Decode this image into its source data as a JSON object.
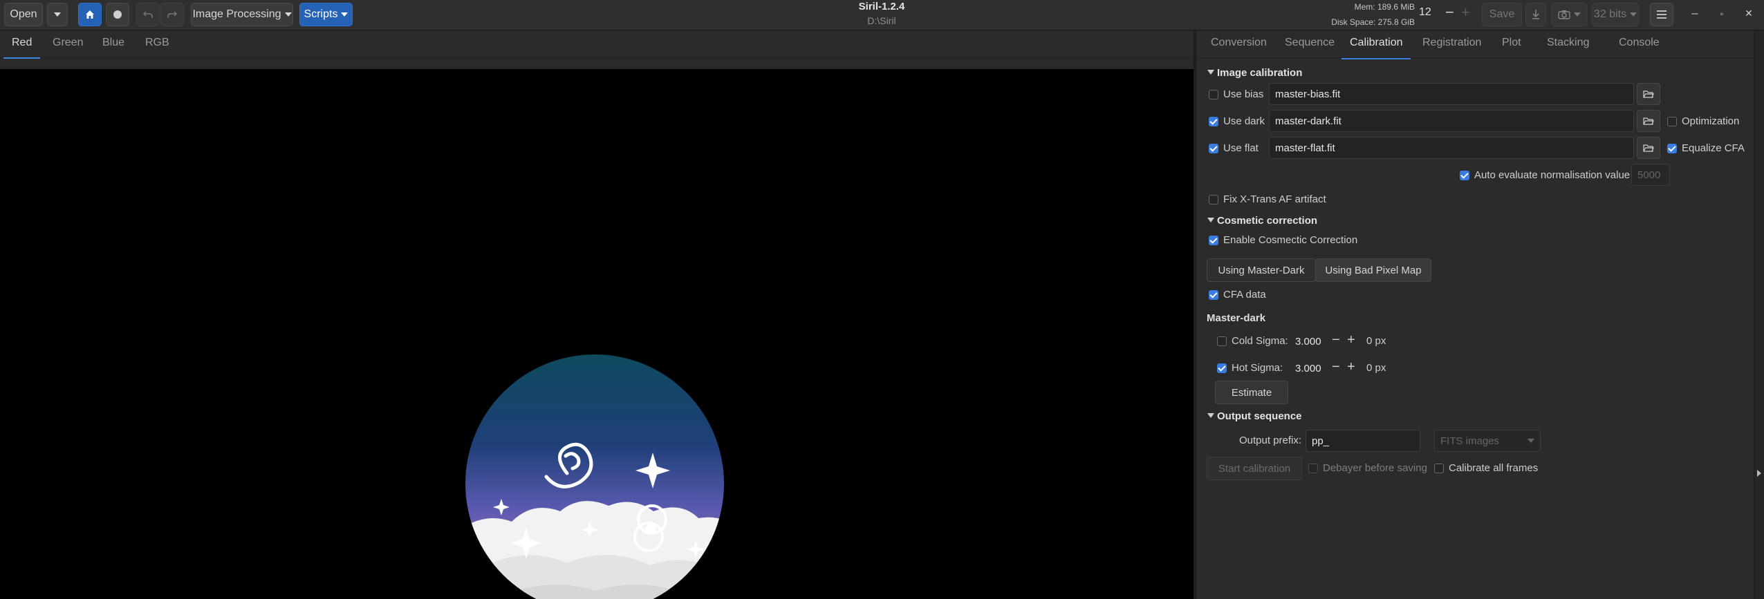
{
  "header": {
    "open_label": "Open",
    "image_processing_label": "Image Processing",
    "scripts_label": "Scripts",
    "title": "Siril-1.2.4",
    "subtitle": "D:\\Siril",
    "mem": "Mem: 189.6 MiB",
    "disk": "Disk Space: 275.8 GiB",
    "thread_count": "12",
    "save_label": "Save",
    "bits_label": "32 bits"
  },
  "left_tabs": [
    "Red",
    "Green",
    "Blue",
    "RGB"
  ],
  "right_tabs": [
    "Conversion",
    "Sequence",
    "Calibration",
    "Registration",
    "Plot",
    "Stacking",
    "Console"
  ],
  "calibration": {
    "image_calibration": {
      "title": "Image calibration",
      "use_bias_label": "Use bias",
      "use_bias": false,
      "bias_file": "master-bias.fit",
      "use_dark_label": "Use dark",
      "use_dark": true,
      "dark_file": "master-dark.fit",
      "optimization_label": "Optimization",
      "optimization": false,
      "use_flat_label": "Use flat",
      "use_flat": true,
      "flat_file": "master-flat.fit",
      "equalize_cfa_label": "Equalize CFA",
      "equalize_cfa": true,
      "auto_eval_label": "Auto evaluate normalisation value",
      "auto_eval": true,
      "norm_value": "5000",
      "fix_xtrans_label": "Fix X-Trans AF artifact",
      "fix_xtrans": false
    },
    "cosmetic": {
      "title": "Cosmetic correction",
      "enable_label": "Enable Cosmectic Correction",
      "enable": true,
      "mode_master_dark": "Using Master-Dark",
      "mode_bad_pixel": "Using Bad Pixel Map",
      "cfa_label": "CFA data",
      "cfa": true,
      "master_dark_title": "Master-dark",
      "cold_sigma_label": "Cold Sigma:",
      "cold_sigma_on": false,
      "cold_sigma_value": "3.000",
      "cold_px": "0 px",
      "hot_sigma_label": "Hot Sigma:",
      "hot_sigma_on": true,
      "hot_sigma_value": "3.000",
      "hot_px": "0 px",
      "estimate_label": "Estimate"
    },
    "output": {
      "title": "Output sequence",
      "prefix_label": "Output prefix:",
      "prefix_value": "pp_",
      "format_value": "FITS images",
      "start_label": "Start calibration",
      "debayer_label": "Debayer before saving",
      "debayer": false,
      "calibrate_all_label": "Calibrate all frames",
      "calibrate_all": false
    }
  },
  "colors": {
    "accent": "#3c82e0",
    "scripts_blue": "#2561b4",
    "sky_top": "#0e4a5e",
    "sky_bottom": "#9a6bb3"
  }
}
